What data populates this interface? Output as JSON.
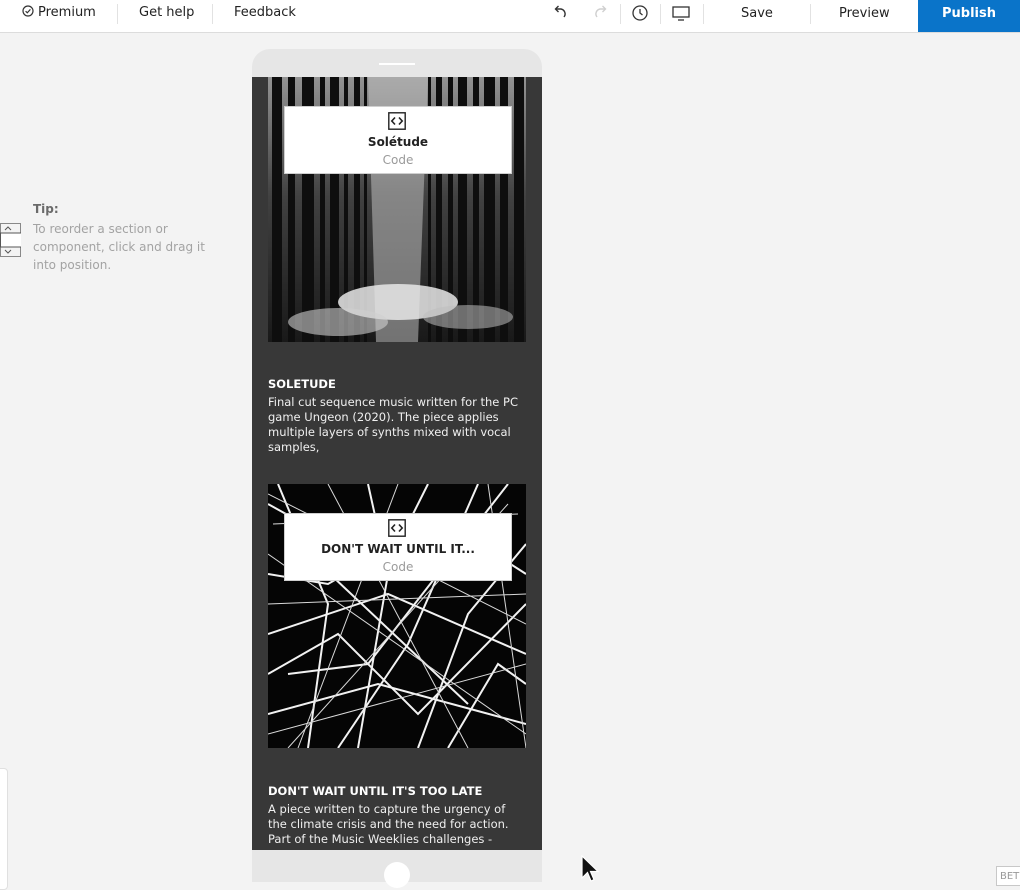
{
  "toolbar": {
    "premium_label": "Premium",
    "help_label": "Get help",
    "feedback_label": "Feedback",
    "save_label": "Save",
    "preview_label": "Preview",
    "publish_label": "Publish",
    "icons": [
      "premium-check-icon",
      "undo-icon",
      "redo-icon",
      "history-icon",
      "desktop-view-icon"
    ]
  },
  "tip": {
    "title": "Tip:",
    "text": "To reorder a section or component, click and drag it into position."
  },
  "phone": {
    "sections": [
      {
        "card_title": "Solétude",
        "card_subtitle": "Code",
        "title": "SOLETUDE",
        "body": "Final cut sequence music written for the PC game Ungeon (2020). The piece applies multiple layers of synths mixed with vocal samples,"
      },
      {
        "card_title": "DON'T WAIT UNTIL IT...",
        "card_subtitle": "Code",
        "title": "DON'T WAIT UNTIL IT'S TOO LATE",
        "body": "A piece written to capture the urgency of the climate crisis and the need for action. Part of the Music Weeklies challenges -"
      }
    ]
  },
  "beta_label": "BET",
  "colors": {
    "publish_bg": "#0a74c9",
    "phone_bg": "#383838",
    "canvas_bg": "#f3f3f3"
  }
}
